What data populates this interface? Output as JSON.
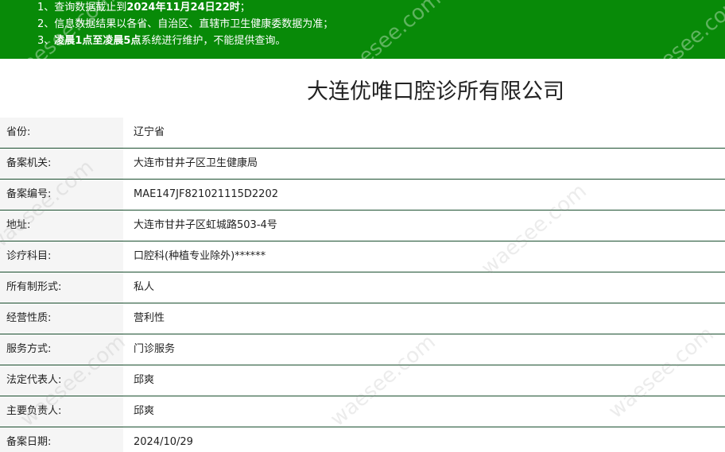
{
  "notice": {
    "line1_prefix": "1、查询数据截止到",
    "line1_bold": "2024年11月24日22时",
    "line1_suffix": "；",
    "line2": "2、信息数据结果以各省、自治区、直辖市卫生健康委数据为准；",
    "line3_prefix": "3、",
    "line3_bold": "凌晨1点至凌晨5点",
    "line3_suffix": "系统进行维护，不能提供查询。"
  },
  "title": "大连优唯口腔诊所有限公司",
  "rows": [
    {
      "label": "省份:",
      "value": "辽宁省"
    },
    {
      "label": "备案机关:",
      "value": "大连市甘井子区卫生健康局"
    },
    {
      "label": "备案编号:",
      "value": "MAE147JF821021115D2202"
    },
    {
      "label": "地址:",
      "value": "大连市甘井子区虹城路503-4号"
    },
    {
      "label": "诊疗科目:",
      "value": "口腔科(种植专业除外)******"
    },
    {
      "label": "所有制形式:",
      "value": "私人"
    },
    {
      "label": "经营性质:",
      "value": "营利性"
    },
    {
      "label": "服务方式:",
      "value": "门诊服务"
    },
    {
      "label": "法定代表人:",
      "value": "邱爽"
    },
    {
      "label": "主要负责人:",
      "value": "邱爽"
    },
    {
      "label": "备案日期:",
      "value": "2024/10/29"
    }
  ],
  "watermark": "waesee.com",
  "colors": {
    "notice_bg": "#088a08",
    "row_border": "#1b4f2f",
    "label_bg": "#f5f5f5"
  }
}
